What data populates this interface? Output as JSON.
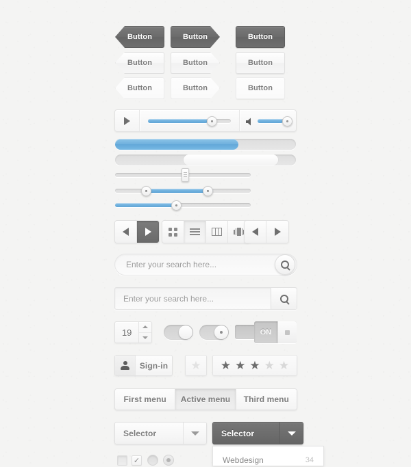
{
  "theme": {
    "background": "#f4f4f3",
    "dark_gray": "#6e6e6e",
    "light_gray": "#f6f6f6",
    "accent_blue": "#6fb0dd",
    "text_gray": "#7d7d7d",
    "placeholder_gray": "#9b9b9b"
  },
  "buttons": {
    "rows": [
      {
        "style": "dark",
        "items": [
          {
            "label": "Button",
            "shape": "arrow-left"
          },
          {
            "label": "Button",
            "shape": "arrow-right"
          },
          {
            "label": "Button",
            "shape": "rectangle"
          }
        ]
      },
      {
        "style": "light",
        "items": [
          {
            "label": "Button",
            "shape": "arrow-left"
          },
          {
            "label": "Button",
            "shape": "arrow-right"
          },
          {
            "label": "Button",
            "shape": "rectangle"
          }
        ]
      },
      {
        "style": "lighter",
        "items": [
          {
            "label": "Button",
            "shape": "arrow-left"
          },
          {
            "label": "Button",
            "shape": "arrow-right"
          },
          {
            "label": "Button",
            "shape": "rectangle"
          }
        ]
      }
    ]
  },
  "player": {
    "play_icon": "play-icon",
    "volume_icon": "volume-icon",
    "seek_percent": 72,
    "volume_percent": 78
  },
  "progress_bars": [
    {
      "name": "blue-progress",
      "percent": 68,
      "fill": "blue"
    },
    {
      "name": "white-progress",
      "start_percent": 38,
      "end_percent": 90,
      "fill": "white"
    }
  ],
  "sliders": [
    {
      "name": "vertical-handle-slider",
      "handle_percent": 50,
      "fill": "none"
    },
    {
      "name": "range-slider",
      "low_percent": 23,
      "high_percent": 72,
      "fill": "blue"
    },
    {
      "name": "single-slider",
      "handle_percent": 44,
      "fill": "blue"
    }
  ],
  "toolbar": {
    "nav_left": {
      "icon": "arrow-left-icon",
      "active": false
    },
    "nav_right": {
      "icon": "arrow-right-icon",
      "active": true
    },
    "views": [
      {
        "icon": "grid-view-icon",
        "active": false
      },
      {
        "icon": "list-view-icon",
        "active": true
      },
      {
        "icon": "column-view-icon",
        "active": false
      },
      {
        "icon": "coverflow-view-icon",
        "active": false
      }
    ],
    "pager": [
      {
        "icon": "arrow-left-icon"
      },
      {
        "icon": "arrow-right-icon"
      }
    ]
  },
  "search": {
    "rounded": {
      "placeholder": "Enter your search here...",
      "value": "",
      "button_icon": "search-icon"
    },
    "square": {
      "placeholder": "Enter your search here...",
      "value": "",
      "button_icon": "search-icon"
    }
  },
  "stepper": {
    "value": "19",
    "up_icon": "caret-up-icon",
    "down_icon": "caret-down-icon"
  },
  "toggles": [
    {
      "name": "pill-toggle-plain",
      "state": "on",
      "knob_mark": false
    },
    {
      "name": "pill-toggle-dot",
      "state": "off",
      "knob_mark": true
    },
    {
      "name": "square-toggle",
      "state": "on",
      "label": ""
    },
    {
      "name": "on-toggle",
      "state": "on",
      "label": "ON"
    }
  ],
  "signin": {
    "label": "Sign-in",
    "icon": "user-icon"
  },
  "rating": {
    "single": {
      "filled": 0,
      "total": 1
    },
    "group": {
      "filled": 3,
      "total": 5
    }
  },
  "tabs": {
    "items": [
      {
        "label": "First menu",
        "active": false
      },
      {
        "label": "Active menu",
        "active": true
      },
      {
        "label": "Third menu",
        "active": false
      }
    ]
  },
  "selectors": [
    {
      "name": "selector-light",
      "label": "Selector",
      "style": "light",
      "icon": "chevron-down-icon"
    },
    {
      "name": "selector-dark",
      "label": "Selector",
      "style": "dark",
      "icon": "chevron-down-icon",
      "open": true
    }
  ],
  "dropdown": {
    "items": [
      {
        "label": "Webdesign",
        "count": "34"
      }
    ]
  },
  "bottom_controls": [
    {
      "name": "checkbox-empty",
      "type": "checkbox",
      "checked": false,
      "glyph": ""
    },
    {
      "name": "checkbox-checked",
      "type": "checkbox",
      "checked": true,
      "glyph": "✓"
    },
    {
      "name": "radio-empty",
      "type": "radio",
      "selected": false
    },
    {
      "name": "radio-selected",
      "type": "radio",
      "selected": true
    }
  ]
}
